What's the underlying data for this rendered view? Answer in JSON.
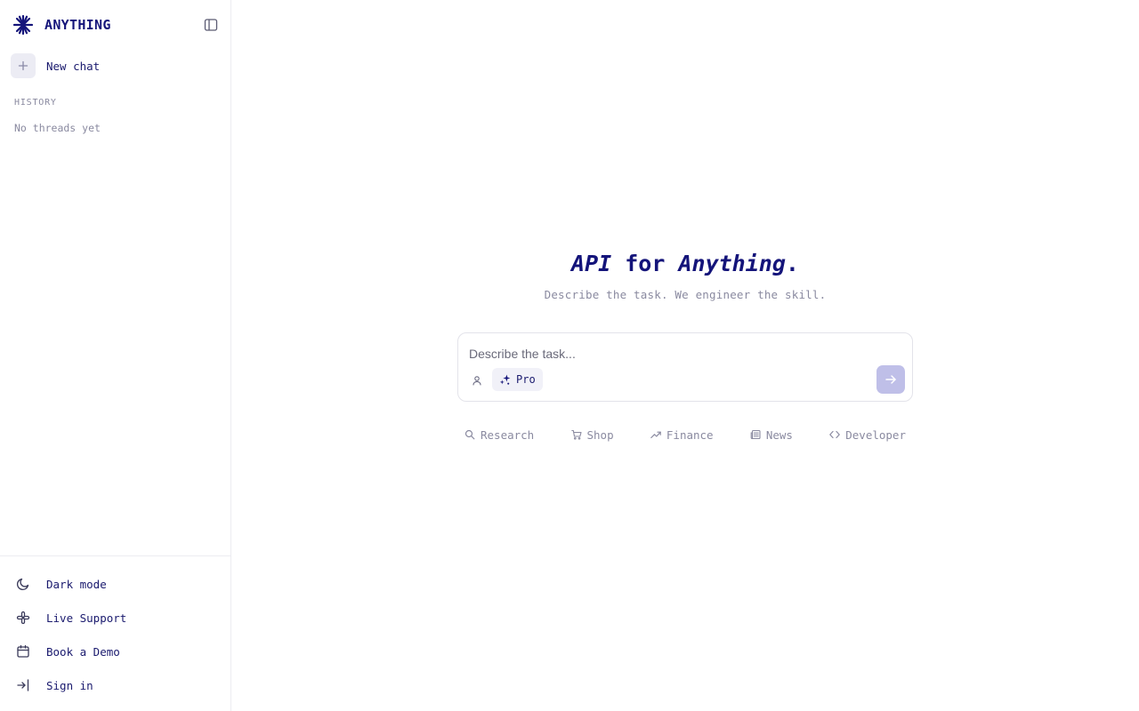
{
  "app": {
    "brand_name": "ANYTHING"
  },
  "sidebar": {
    "new_chat_label": "New chat",
    "history_heading": "HISTORY",
    "history_empty": "No threads yet",
    "footer": [
      {
        "label": "Dark mode",
        "icon": "moon-icon"
      },
      {
        "label": "Live Support",
        "icon": "slack-icon"
      },
      {
        "label": "Book a Demo",
        "icon": "calendar-icon"
      },
      {
        "label": "Sign in",
        "icon": "sign-in-icon"
      }
    ]
  },
  "hero": {
    "title_part1": "API",
    "title_part2": " for ",
    "title_part3": "Anything",
    "title_part4": ".",
    "subtitle": "Describe the task. We engineer the skill."
  },
  "composer": {
    "placeholder": "Describe the task...",
    "value": "",
    "mode_label": "Pro"
  },
  "categories": [
    {
      "label": "Research",
      "icon": "search-icon"
    },
    {
      "label": "Shop",
      "icon": "cart-icon"
    },
    {
      "label": "Finance",
      "icon": "trending-up-icon"
    },
    {
      "label": "News",
      "icon": "newspaper-icon"
    },
    {
      "label": "Developer",
      "icon": "code-icon"
    }
  ],
  "colors": {
    "brand": "#14147a",
    "muted": "#8a8aa0",
    "send_button": "#bfbfe8",
    "chip_bg": "#f1f1f8"
  }
}
